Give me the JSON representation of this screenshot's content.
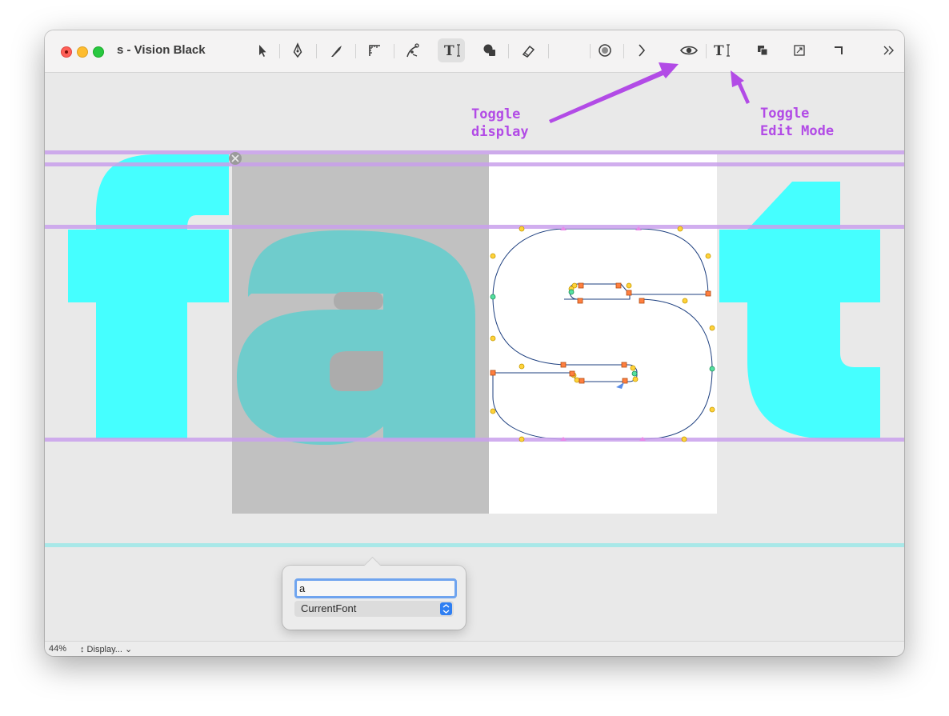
{
  "window": {
    "title": "s - Vision Black"
  },
  "toolbar": {
    "tools": [
      {
        "icon": "pointer-icon"
      },
      {
        "icon": "pen-icon"
      },
      {
        "icon": "knife-icon"
      },
      {
        "icon": "measure-icon"
      },
      {
        "icon": "bezier-icon"
      },
      {
        "icon": "text-tool-icon",
        "active": true
      },
      {
        "icon": "shapes-icon"
      },
      {
        "icon": "eraser-icon"
      },
      {
        "icon": "stamp-icon"
      },
      {
        "icon": "chevron-right-icon"
      },
      {
        "icon": "eye-icon"
      },
      {
        "icon": "text-edit-mode-icon"
      },
      {
        "icon": "layers-icon"
      },
      {
        "icon": "add-frame-icon"
      },
      {
        "icon": "corner-icon"
      },
      {
        "icon": "overflow-chevrons-icon"
      }
    ]
  },
  "canvas": {
    "text_line": "fast",
    "selected_glyph": "s",
    "glyph_fill_color": "#45ffff",
    "outline_color": "#1d3f7f",
    "guide_color": "#c9a0ec",
    "on_curve_point_color": "#ff7f3f",
    "off_curve_point_color": "#ffd23a",
    "smooth_point_color": "#55e0a0"
  },
  "popover": {
    "glyph_input_value": "a",
    "font_select_label": "CurrentFont"
  },
  "statusbar": {
    "zoom": "44%",
    "display_menu": "↕ Display... ⌄"
  },
  "annotations": {
    "toggle_display": "Toggle\ndisplay",
    "toggle_edit_mode": "Toggle\nEdit Mode",
    "color": "#b24be6"
  }
}
